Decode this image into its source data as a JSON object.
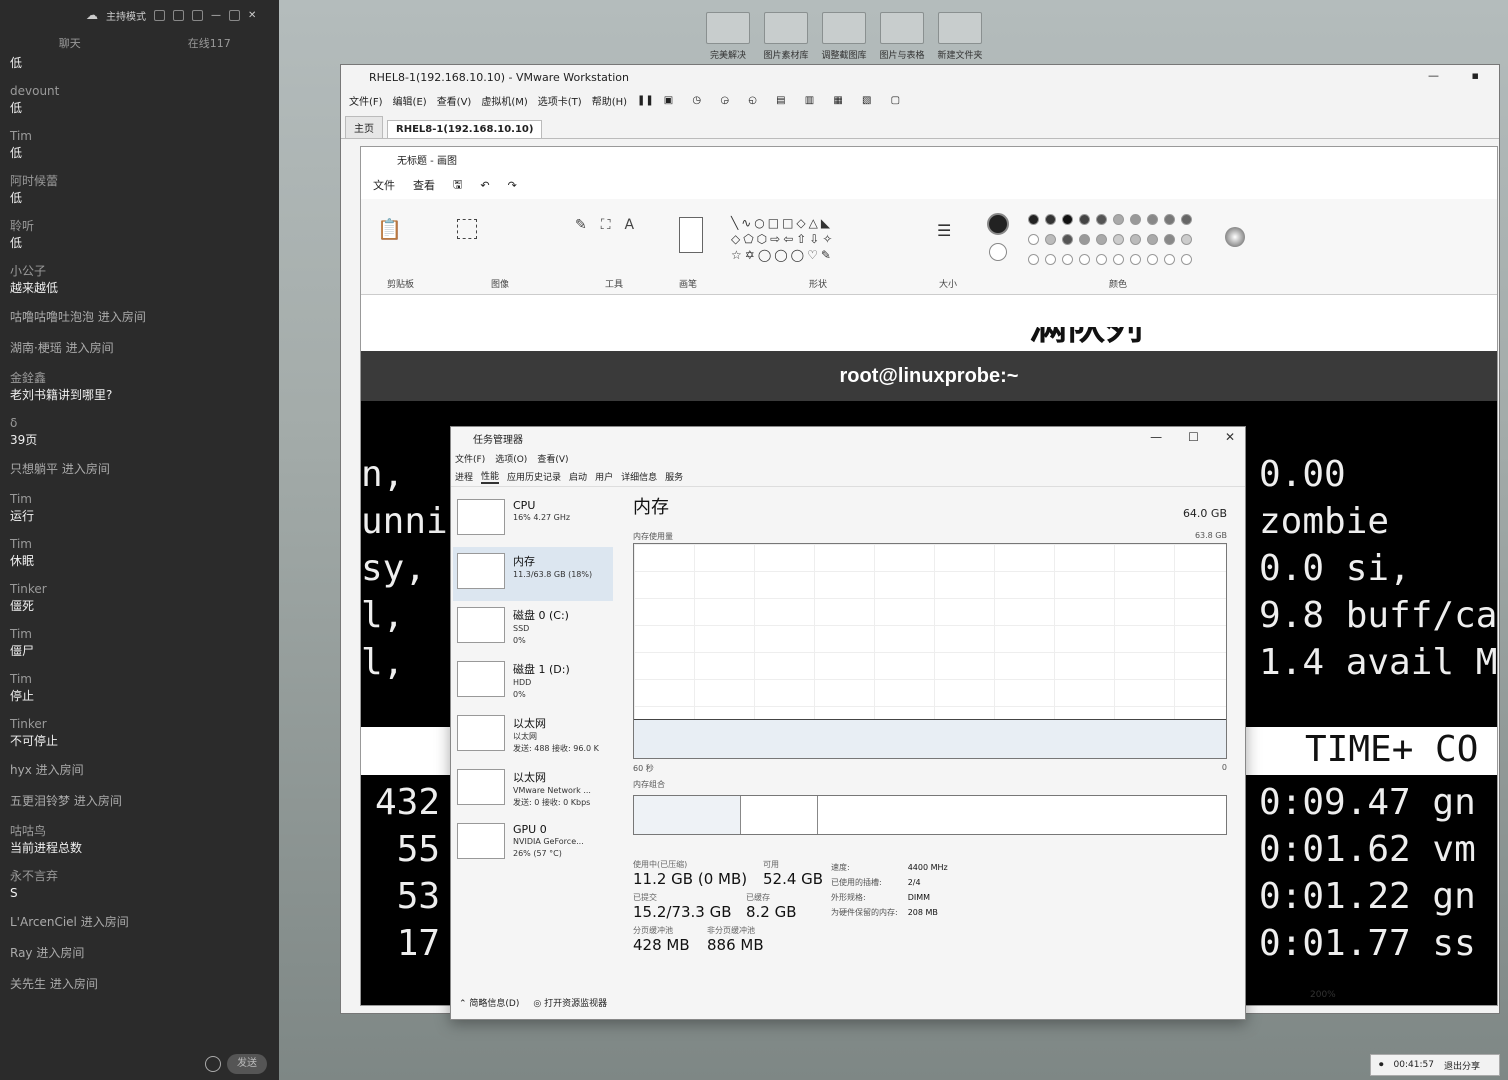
{
  "chat": {
    "header": {
      "mode": "主持模式"
    },
    "tabs": [
      "聊天",
      "在线117"
    ],
    "messages": [
      {
        "name": "",
        "text": "低"
      },
      {
        "name": "devount",
        "text": "低"
      },
      {
        "name": "Tim",
        "text": "低"
      },
      {
        "name": "阿时候蕾",
        "text": "低"
      },
      {
        "name": "聆听",
        "text": "低"
      },
      {
        "name": "小公子",
        "text": "越来越低"
      },
      {
        "name": "",
        "text": "咕噜咕噜吐泡泡 进入房间",
        "system": true
      },
      {
        "name": "",
        "text": "湖南·梗瑶 进入房间",
        "system": true
      },
      {
        "name": "金銓鑫",
        "text": "老刘书籍讲到哪里?"
      },
      {
        "name": "δ",
        "text": "39页"
      },
      {
        "name": "",
        "text": "只想躺平 进入房间",
        "system": true
      },
      {
        "name": "Tim",
        "text": "运行"
      },
      {
        "name": "Tim",
        "text": "休眠"
      },
      {
        "name": "Tinker",
        "text": "僵死"
      },
      {
        "name": "Tim",
        "text": "僵尸"
      },
      {
        "name": "Tim",
        "text": "停止"
      },
      {
        "name": "Tinker",
        "text": "不可停止"
      },
      {
        "name": "",
        "text": "hyx 进入房间",
        "system": true
      },
      {
        "name": "",
        "text": "五更泪铃梦 进入房间",
        "system": true
      },
      {
        "name": "咕咕鸟",
        "text": "当前进程总数"
      },
      {
        "name": "永不言弃",
        "text": "S"
      },
      {
        "name": "",
        "text": "L'ArcenCiel 进入房间",
        "system": true
      },
      {
        "name": "",
        "text": "Ray 进入房间",
        "system": true
      },
      {
        "name": "",
        "text": "关先生 进入房间",
        "system": true
      }
    ],
    "send_label": "发送"
  },
  "desktop_icons": [
    "完美解决",
    "图片素材库",
    "调整截图库",
    "图片与表格",
    "新建文件夹"
  ],
  "vmware": {
    "title": "RHEL8-1(192.168.10.10) - VMware Workstation",
    "menu": [
      "文件(F)",
      "编辑(E)",
      "查看(V)",
      "虚拟机(M)",
      "选项卡(T)",
      "帮助(H)"
    ],
    "tabs": [
      "主页",
      "RHEL8-1(192.168.10.10)"
    ]
  },
  "paint": {
    "title": "无标题 - 画图",
    "menu": [
      "文件",
      "查看"
    ],
    "groups": [
      "剪贴板",
      "图像",
      "工具",
      "画笔",
      "形状",
      "大小",
      "颜色"
    ],
    "zoom": "200%"
  },
  "terminal": {
    "top_text": "满队列",
    "title": "root@linuxprobe:~",
    "left_lines": [
      "n,",
      "unni",
      "sy,",
      "l,",
      "l,"
    ],
    "right_lines": [
      "0.00",
      "zombie",
      "0.0 si,",
      "9.8 buff/ca",
      "1.4 avail M"
    ],
    "header_right": "TIME+ CO",
    "rows_left": [
      "432",
      "55",
      "53",
      "17"
    ],
    "rows_right": [
      "0:09.47 gn",
      "0:01.62 vm",
      "0:01.22 gn",
      "0:01.77 ss"
    ]
  },
  "taskmgr": {
    "title": "任务管理器",
    "menu": [
      "文件(F)",
      "选项(O)",
      "查看(V)"
    ],
    "tabs": [
      "进程",
      "性能",
      "应用历史记录",
      "启动",
      "用户",
      "详细信息",
      "服务"
    ],
    "resources": [
      {
        "name": "CPU",
        "sub1": "16% 4.27 GHz",
        "sub2": ""
      },
      {
        "name": "内存",
        "sub1": "11.3/63.8 GB (18%)",
        "sub2": ""
      },
      {
        "name": "磁盘 0 (C:)",
        "sub1": "SSD",
        "sub2": "0%"
      },
      {
        "name": "磁盘 1 (D:)",
        "sub1": "HDD",
        "sub2": "0%"
      },
      {
        "name": "以太网",
        "sub1": "以太网",
        "sub2": "发送: 488 接收: 96.0 K"
      },
      {
        "name": "以太网",
        "sub1": "VMware Network ...",
        "sub2": "发送: 0 接收: 0 Kbps"
      },
      {
        "name": "GPU 0",
        "sub1": "NVIDIA GeForce...",
        "sub2": "26% (57 °C)"
      }
    ],
    "memory": {
      "heading": "内存",
      "total": "64.0 GB",
      "usage_label": "内存使用量",
      "usage_max": "63.8 GB",
      "axis_left": "60 秒",
      "axis_right": "0",
      "composition_label": "内存组合",
      "used_fraction": 0.18,
      "in_use_label": "使用中(已压缩)",
      "in_use": "11.2 GB (0 MB)",
      "available_label": "可用",
      "available": "52.4 GB",
      "committed_label": "已提交",
      "committed": "15.2/73.3 GB",
      "cached_label": "已缓存",
      "cached": "8.2 GB",
      "paged_label": "分页缓冲池",
      "paged": "428 MB",
      "nonpaged_label": "非分页缓冲池",
      "nonpaged": "886 MB",
      "props": [
        {
          "k": "速度:",
          "v": "4400 MHz"
        },
        {
          "k": "已使用的插槽:",
          "v": "2/4"
        },
        {
          "k": "外形规格:",
          "v": "DIMM"
        },
        {
          "k": "为硬件保留的内存:",
          "v": "208 MB"
        }
      ]
    },
    "footer": {
      "summary": "简略信息(D)",
      "monitor": "打开资源监视器"
    }
  },
  "share": {
    "time": "00:41:57",
    "exit": "退出分享"
  }
}
